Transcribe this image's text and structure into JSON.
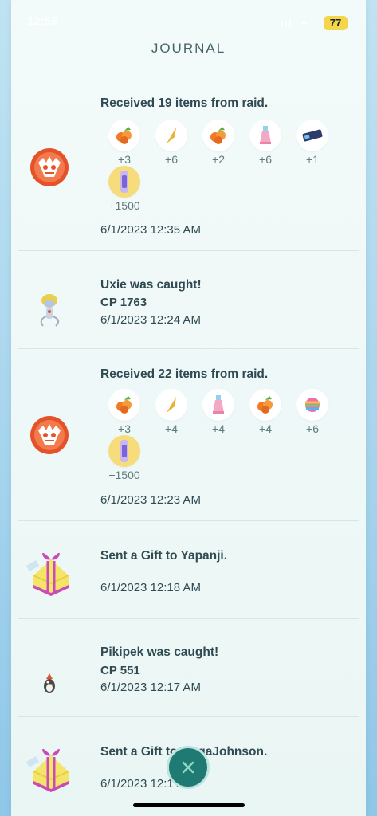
{
  "status": {
    "time": "12:55",
    "battery": "77"
  },
  "journal": {
    "title": "JOURNAL"
  },
  "entries": [
    {
      "heading": "Received 19 items from raid.",
      "items": [
        {
          "icon": "razz-berry-icon",
          "qty": "+3"
        },
        {
          "icon": "rare-candy-icon",
          "qty": "+6"
        },
        {
          "icon": "razz-berry-icon",
          "qty": "+2"
        },
        {
          "icon": "potion-icon",
          "qty": "+6"
        },
        {
          "icon": "tm-icon",
          "qty": "+1"
        },
        {
          "icon": "mega-energy-icon",
          "qty": "+1500"
        }
      ],
      "timestamp": "6/1/2023 12:35 AM"
    },
    {
      "heading": "Uxie was caught!",
      "cp": "CP 1763",
      "timestamp": "6/1/2023 12:24 AM"
    },
    {
      "heading": "Received 22 items from raid.",
      "items": [
        {
          "icon": "razz-berry-icon",
          "qty": "+3"
        },
        {
          "icon": "rare-candy-icon",
          "qty": "+4"
        },
        {
          "icon": "potion-icon",
          "qty": "+4"
        },
        {
          "icon": "razz-berry-icon",
          "qty": "+4"
        },
        {
          "icon": "rainbow-candy-icon",
          "qty": "+6"
        },
        {
          "icon": "mega-energy-icon",
          "qty": "+1500"
        }
      ],
      "timestamp": "6/1/2023 12:23 AM"
    },
    {
      "heading": "Sent a Gift to Yapanji.",
      "timestamp": "6/1/2023 12:18 AM"
    },
    {
      "heading": "Pikipek was caught!",
      "cp": "CP 551",
      "timestamp": "6/1/2023 12:17 AM"
    },
    {
      "heading": "Sent a Gift to MegaJohnson.",
      "timestamp": "6/1/2023 12:1 AM"
    }
  ],
  "colors": {
    "accent": "#1f7a73",
    "text": "#2f4a52",
    "raid": "#e5522a",
    "gold": "#f6dc7b"
  }
}
